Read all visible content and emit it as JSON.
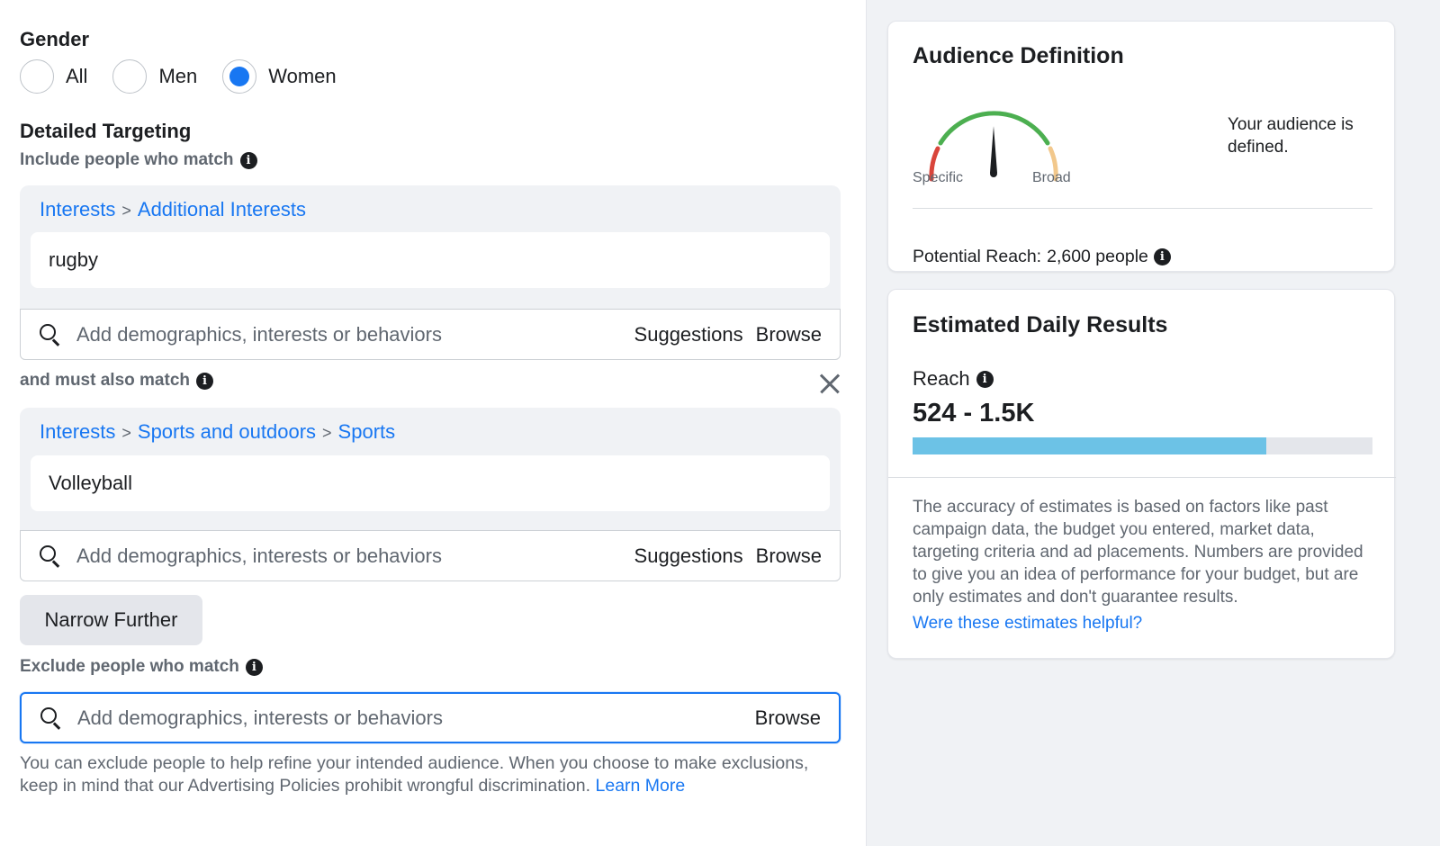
{
  "gender": {
    "title": "Gender",
    "options": [
      {
        "label": "All",
        "checked": false
      },
      {
        "label": "Men",
        "checked": false
      },
      {
        "label": "Women",
        "checked": true
      }
    ]
  },
  "detailed_targeting": {
    "title": "Detailed Targeting",
    "include_label": "Include people who match",
    "include_group": {
      "breadcrumb": [
        "Interests",
        "Additional Interests"
      ],
      "chip": "rugby",
      "search_placeholder": "Add demographics, interests or behaviors",
      "suggestions": "Suggestions",
      "browse": "Browse"
    },
    "must_match_label": "and must also match",
    "must_group": {
      "breadcrumb": [
        "Interests",
        "Sports and outdoors",
        "Sports"
      ],
      "chip": "Volleyball",
      "search_placeholder": "Add demographics, interests or behaviors",
      "suggestions": "Suggestions",
      "browse": "Browse"
    },
    "breadcrumb_separator": ">",
    "narrow_button": "Narrow Further",
    "exclude_label": "Exclude people who match",
    "exclude_search": {
      "placeholder": "Add demographics, interests or behaviors",
      "browse": "Browse"
    },
    "footnote": "You can exclude people to help refine your intended audience. When you choose to make exclusions, keep in mind that our Advertising Policies prohibit wrongful discrimination.",
    "learn_more": "Learn More"
  },
  "audience_definition": {
    "title": "Audience Definition",
    "gauge": {
      "left_label": "Specific",
      "right_label": "Broad",
      "level": 0.5
    },
    "status_text": "Your audience is defined.",
    "potential_reach_label": "Potential Reach:",
    "potential_reach_value": "2,600 people"
  },
  "estimated_results": {
    "title": "Estimated Daily Results",
    "reach_label": "Reach",
    "reach_value": "524 - 1.5K",
    "reach_fraction": 0.77,
    "accuracy_text": "The accuracy of estimates is based on factors like past campaign data, the budget you entered, market data, targeting criteria and ad placements. Numbers are provided to give you an idea of performance for your budget, but are only estimates and don't guarantee results.",
    "helpful_link": "Were these estimates helpful?"
  },
  "colors": {
    "accent": "#1877f2",
    "gauge_green": "#4caf50",
    "gauge_red": "#d9453b",
    "gauge_peach": "#f2c88c",
    "reach_bar": "#6cc2e6"
  },
  "icons": [
    "info-icon",
    "search-icon",
    "close-icon",
    "gauge-needle-icon"
  ]
}
